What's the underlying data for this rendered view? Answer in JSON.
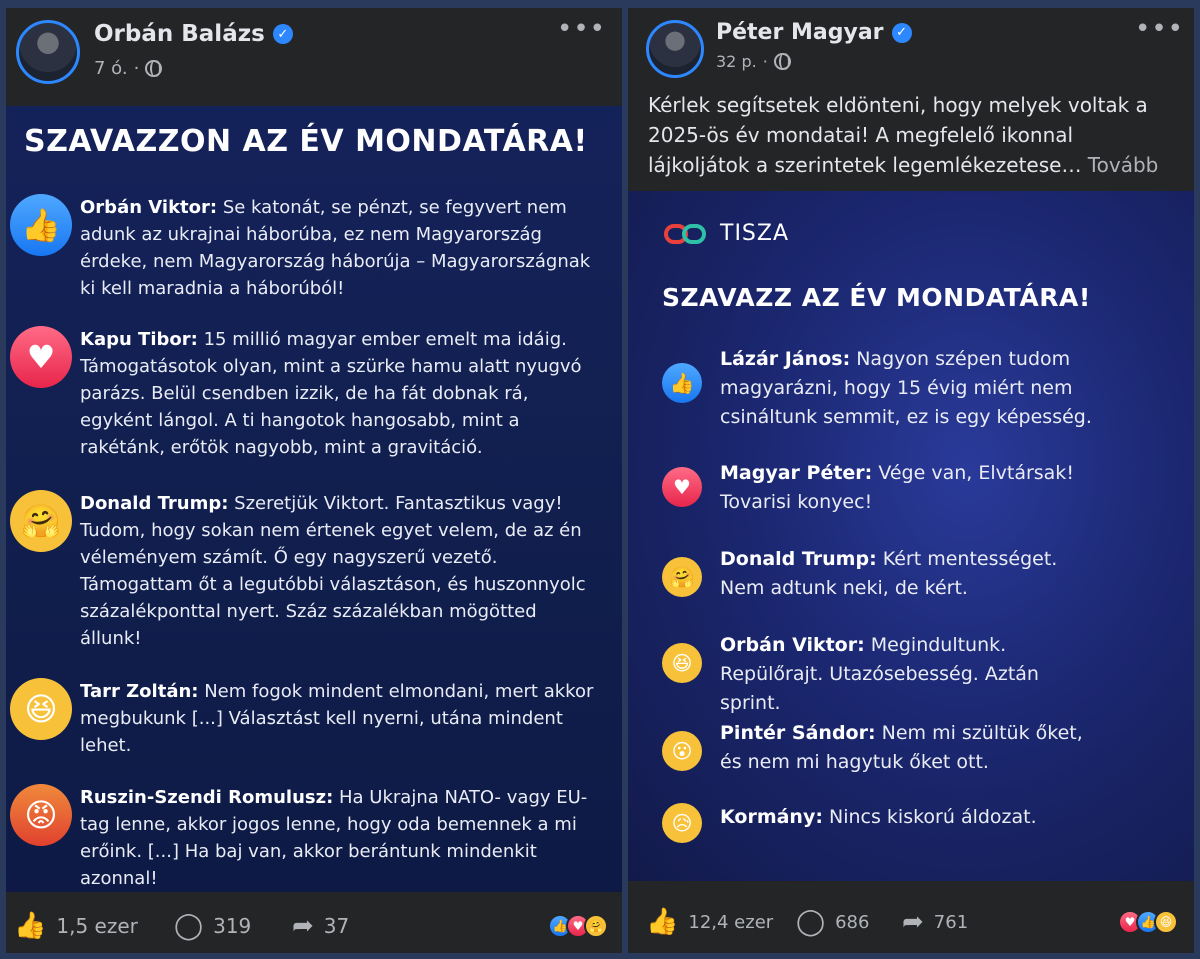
{
  "left_post": {
    "author": "Orbán Balázs",
    "time": "7 ó.",
    "card": {
      "title": "SZAVAZZON AZ ÉV MONDATÁRA!",
      "quotes": [
        {
          "reaction": "like",
          "speaker": "Orbán Viktor:",
          "text": "Se katonát, se pénzt, se fegyvert nem adunk az ukrajnai háborúba, ez nem Magyarország érdeke, nem Magyarország háborúja – Magyarországnak ki kell maradnia a háborúból!"
        },
        {
          "reaction": "love",
          "speaker": "Kapu Tibor:",
          "text": "15 millió magyar ember emelt ma idáig. Támogatásotok olyan, mint a szürke hamu alatt nyugvó parázs. Belül csendben izzik, de ha fát dobnak rá, egyként lángol. A ti hangotok hangosabb, mint a rakétánk, erőtök nagyobb, mint a gravitáció."
        },
        {
          "reaction": "care",
          "speaker": "Donald Trump:",
          "text": "Szeretjük Viktort. Fantasztikus vagy! Tudom, hogy sokan nem értenek egyet velem, de az én véleményem számít. Ő egy nagyszerű vezető. Támogattam őt a legutóbbi választáson, és huszonnyolc százalékponttal nyert. Száz százalékban mögötted állunk!"
        },
        {
          "reaction": "haha",
          "speaker": "Tarr Zoltán:",
          "text": "Nem fogok mindent elmondani, mert akkor megbukunk [...] Választást kell nyerni, utána mindent lehet."
        },
        {
          "reaction": "angry",
          "speaker": "Ruszin-Szendi Romulusz:",
          "text": "Ha Ukrajna NATO- vagy EU-tag lenne, akkor jogos lenne, hogy oda bemennek a mi erőink. [...] Ha baj van, akkor berántunk mindenkit azonnal!"
        }
      ]
    },
    "actions": {
      "likes": "1,5 ezer",
      "comments": "319",
      "shares": "37"
    }
  },
  "right_post": {
    "author": "Péter Magyar",
    "time": "32 p.",
    "caption": "Kérlek segítsetek eldönteni, hogy melyek voltak a 2025-ös év mondatai! A megfelelő ikonnal lájkoljátok a szerintetek legemlékezetese…",
    "see_more": "Tovább",
    "card": {
      "brand": "TISZA",
      "title": "SZAVAZZ AZ ÉV MONDATÁRA!",
      "quotes": [
        {
          "reaction": "like",
          "speaker": "Lázár János:",
          "text": "Nagyon szépen tudom magyarázni, hogy 15 évig miért nem csináltunk semmit, ez is egy képesség."
        },
        {
          "reaction": "love",
          "speaker": "Magyar Péter:",
          "text": "Vége van, Elvtársak! Tovarisi konyec!"
        },
        {
          "reaction": "care",
          "speaker": "Donald Trump:",
          "text": "Kért mentességet. Nem adtunk neki, de kért."
        },
        {
          "reaction": "haha",
          "speaker": "Orbán Viktor:",
          "text": "Megindultunk. Repülőrajt. Utazósebesség. Aztán sprint."
        },
        {
          "reaction": "wow",
          "speaker": "Pintér Sándor:",
          "text": "Nem mi szültük őket, és nem mi hagytuk őket ott."
        },
        {
          "reaction": "sad",
          "speaker": "Kormány:",
          "text": "Nincs kiskorú áldozat."
        }
      ]
    },
    "actions": {
      "likes": "12,4 ezer",
      "comments": "686",
      "shares": "761"
    }
  },
  "icons": {
    "like": "👍",
    "love": "♥",
    "care": "🤗",
    "haha": "😆",
    "wow": "😮",
    "angry": "😡",
    "sad": "😥",
    "more": "•••",
    "verified": "✓",
    "comment": "◯",
    "share": "➦"
  },
  "colors": {
    "facebook_blue": "#2d88ff",
    "card_navy": "#111f4f",
    "tisza_red": "#e8413c",
    "tisza_teal": "#2fc1a8"
  }
}
